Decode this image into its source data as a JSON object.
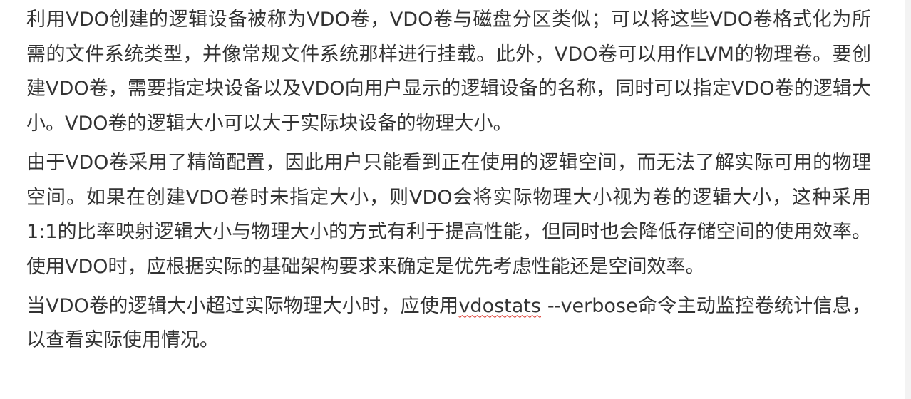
{
  "document": {
    "paragraphs": [
      {
        "text": "利用VDO创建的逻辑设备被称为VDO卷，VDO卷与磁盘分区类似；可以将这些VDO卷格式化为所需的文件系统类型，并像常规文件系统那样进行挂载。此外，VDO卷可以用作LVM的物理卷。要创建VDO卷，需要指定块设备以及VDO向用户显示的逻辑设备的名称，同时可以指定VDO卷的逻辑大小。VDO卷的逻辑大小可以大于实际块设备的物理大小。"
      },
      {
        "text": "由于VDO卷采用了精简配置，因此用户只能看到正在使用的逻辑空间，而无法了解实际可用的物理空间。如果在创建VDO卷时未指定大小，则VDO会将实际物理大小视为卷的逻辑大小，这种采用1:1的比率映射逻辑大小与物理大小的方式有利于提高性能，但同时也会降低存储空间的使用效率。使用VDO时，应根据实际的基础架构要求来确定是优先考虑性能还是空间效率。"
      },
      {
        "before": "当VDO卷的逻辑大小超过实际物理大小时，应使用",
        "command": "vdostats",
        "after": " --verbose命令主动监控卷统计信息，以查看实际使用情况。"
      }
    ]
  },
  "colors": {
    "text": "#333333",
    "background": "#ffffff",
    "spellcheck_underline": "#d93025"
  }
}
